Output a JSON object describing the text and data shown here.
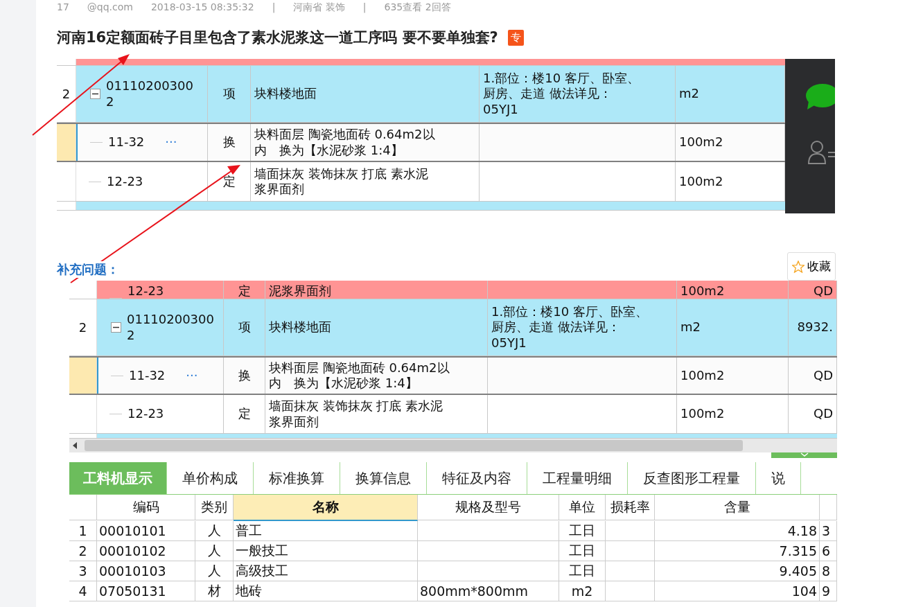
{
  "post_meta": [
    "17",
    "@qq.com",
    "2018-03-15 08:35:32",
    "|",
    "河南省 装饰",
    "|",
    "635查看 2回答"
  ],
  "title": "河南16定额面砖子目里包含了素水泥浆这一道工序吗 要不要单独套?",
  "badge": "专",
  "screenshot_1": {
    "rows": [
      {
        "kind": "edge",
        "color": "#ff9494"
      },
      {
        "kind": "parent",
        "color": "#aee8f8",
        "number": "2",
        "code": "011102003002",
        "expanded": true,
        "type": "项",
        "name": "块料楼地面",
        "feature": "1.部位：楼10 客厅、卧室、厨房、走道 做法详见：05YJ1",
        "unit": "m2"
      },
      {
        "kind": "child",
        "color": "#fbfbfb",
        "selected": true,
        "code": "11-32",
        "more": "···",
        "type": "换",
        "name": "块料面层 陶瓷地面砖 0.64m2以内　换为【水泥砂浆 1:4】",
        "unit": "100m2"
      },
      {
        "kind": "child",
        "color": "#ffffff",
        "selected": false,
        "code": "12-23",
        "type": "定",
        "name": "墙面抹灰 装饰抹灰 打底 素水泥浆界面剂",
        "unit": "100m2"
      },
      {
        "kind": "edge",
        "color": "#aee8f8"
      }
    ]
  },
  "supplement_label": "补充问题：",
  "collect_button": "收藏",
  "screenshot_2": {
    "rows": [
      {
        "kind": "child",
        "color": "#ff9494",
        "selected": false,
        "code": "12-23",
        "type": "定",
        "name": "泥浆界面剂",
        "unit": "100m2",
        "column_7": "QD"
      },
      {
        "kind": "parent",
        "color": "#aee8f8",
        "number": "2",
        "code": "011102003002",
        "expanded": true,
        "type": "项",
        "name": "块料楼地面",
        "feature": "1.部位：楼10 客厅、卧室、厨房、走道 做法详见：05YJ1",
        "unit": "m2",
        "column_7": "8932."
      },
      {
        "kind": "child",
        "color": "#fbfbfb",
        "selected": true,
        "code": "11-32",
        "more": "···",
        "type": "换",
        "name": "块料面层 陶瓷地面砖 0.64m2以内　换为【水泥砂浆 1:4】",
        "unit": "100m2",
        "column_7": "QD"
      },
      {
        "kind": "child",
        "color": "#ffffff",
        "selected": false,
        "code": "12-23",
        "type": "定",
        "name": "墙面抹灰 装饰抹灰 打底 素水泥浆界面剂",
        "unit": "100m2",
        "column_7": "QD"
      },
      {
        "kind": "edge",
        "color": "#aee8f8"
      }
    ],
    "tabs": [
      {
        "label": "工料机显示",
        "selected": true
      },
      {
        "label": "单价构成",
        "selected": false
      },
      {
        "label": "标准换算",
        "selected": false
      },
      {
        "label": "换算信息",
        "selected": false
      },
      {
        "label": "特征及内容",
        "selected": false
      },
      {
        "label": "工程量明细",
        "selected": false
      },
      {
        "label": "反查图形工程量",
        "selected": false
      },
      {
        "label": "说",
        "selected": false
      }
    ],
    "columns": [
      {
        "label": "编码",
        "selected": false
      },
      {
        "label": "类别",
        "selected": false
      },
      {
        "label": "名称",
        "selected": true
      },
      {
        "label": "规格及型号",
        "selected": false
      },
      {
        "label": "单位",
        "selected": false
      },
      {
        "label": "损耗率",
        "selected": false
      },
      {
        "label": "含量",
        "selected": false
      }
    ],
    "materials": [
      {
        "number": "1",
        "code": "00010101",
        "type": "人",
        "name": "普工",
        "unit": "工日",
        "amount": "4.18",
        "column_9": "3"
      },
      {
        "number": "2",
        "code": "00010102",
        "type": "人",
        "name": "一般技工",
        "unit": "工日",
        "amount": "7.315",
        "column_9": "6"
      },
      {
        "number": "3",
        "code": "00010103",
        "type": "人",
        "name": "高级技工",
        "unit": "工日",
        "amount": "9.405",
        "column_9": "8"
      },
      {
        "number": "4",
        "code": "07050131",
        "type": "材",
        "name": "地砖",
        "spec": "800mm*800mm",
        "unit": "m2",
        "amount": "104",
        "column_9": "9"
      }
    ]
  }
}
